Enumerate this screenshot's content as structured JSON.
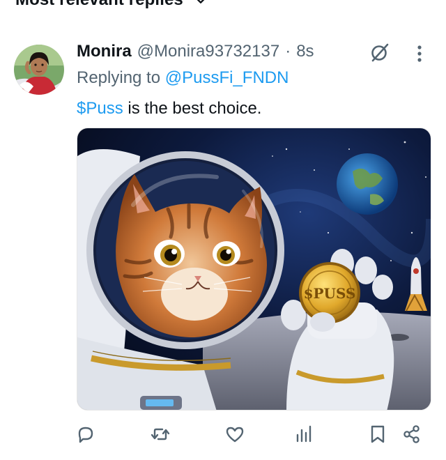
{
  "header": {
    "sort_label": "Most relevant replies"
  },
  "reply": {
    "author_name": "Monira",
    "handle": "@Monira93732137",
    "separator": "·",
    "time": "8s",
    "replying_prefix": "Replying to",
    "replying_to": "@PussFi_FNDN",
    "text_cashtag": "$Puss",
    "text_rest": " is the best choice.",
    "media": {
      "coin_text": "$PUSS"
    }
  },
  "actions": [
    "reply-icon",
    "retweet-icon",
    "like-icon",
    "views-icon",
    "bookmark-icon",
    "share-icon"
  ],
  "colors": {
    "link": "#1d9bf0",
    "secondary": "#536471",
    "text": "#0f1419"
  }
}
